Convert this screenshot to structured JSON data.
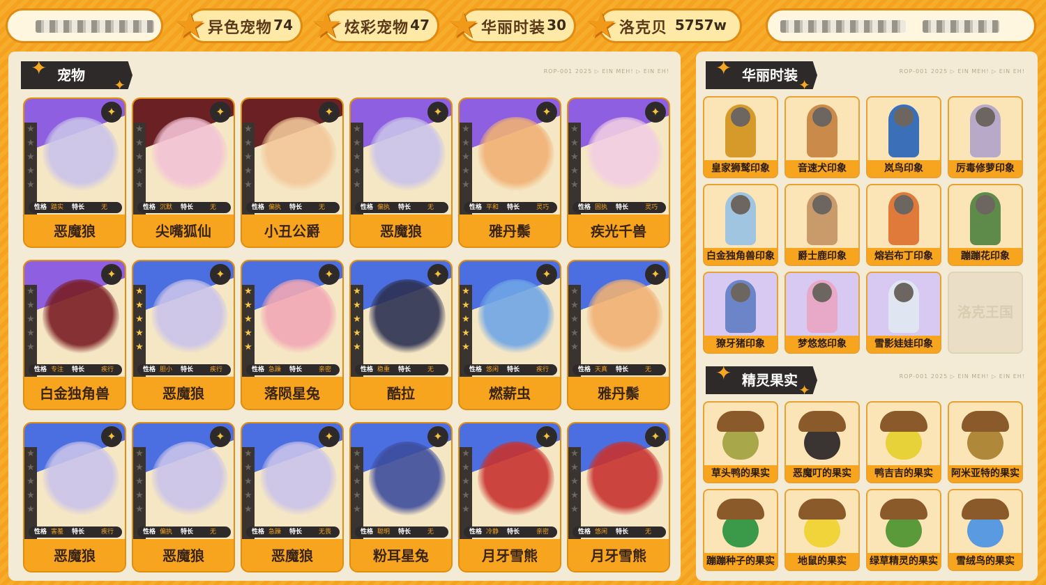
{
  "topbar": {
    "stats": [
      {
        "label": "异色宠物",
        "value": "74"
      },
      {
        "label": "炫彩宠物",
        "value": "47"
      },
      {
        "label": "华丽时装",
        "value": "30"
      },
      {
        "label": "洛克贝",
        "value": "5757w"
      }
    ]
  },
  "pets_panel": {
    "title": "宠物",
    "tiny": "ROP-001  2025  ▷ EIN MEH! ▷ EIN EH!",
    "attr_k1": "性格",
    "attr_k2": "特长",
    "cards": [
      {
        "name": "恶魔狼",
        "trait": "踏实",
        "skill": "无",
        "theme": "purple",
        "badge": "✦",
        "color": "#c9c3ea",
        "stars": 0
      },
      {
        "name": "尖嘴狐仙",
        "trait": "沉默",
        "skill": "无",
        "theme": "dark",
        "badge": "✦",
        "color": "#f3c2d6",
        "stars": 0
      },
      {
        "name": "小丑公爵",
        "trait": "偏执",
        "skill": "无",
        "theme": "dark",
        "badge": "✦",
        "color": "#f2c79a",
        "stars": 0
      },
      {
        "name": "恶魔狼",
        "trait": "偏执",
        "skill": "无",
        "theme": "purple",
        "badge": "✦",
        "color": "#c9c3ea",
        "stars": 0
      },
      {
        "name": "雅丹鬃",
        "trait": "平和",
        "skill": "灵巧",
        "theme": "purple",
        "badge": "✦",
        "color": "#f0b074",
        "stars": 0
      },
      {
        "name": "疾光千兽",
        "trait": "固执",
        "skill": "灵巧",
        "theme": "purple",
        "badge": "✦",
        "color": "#f2cde3",
        "stars": 0
      },
      {
        "name": "白金独角兽",
        "trait": "专注",
        "skill": "疾行",
        "theme": "purple",
        "badge": "✦",
        "color": "#7a1d24",
        "stars": 0
      },
      {
        "name": "恶魔狼",
        "trait": "胆小",
        "skill": "疾行",
        "theme": "blue",
        "badge": "✦",
        "color": "#c9c3ea",
        "stars": 5
      },
      {
        "name": "落陨星兔",
        "trait": "急躁",
        "skill": "亲密",
        "theme": "blue",
        "badge": "✦",
        "color": "#f2a7b4",
        "stars": 5
      },
      {
        "name": "酷拉",
        "trait": "稳重",
        "skill": "无",
        "theme": "blue",
        "badge": "✦",
        "color": "#2c3152",
        "stars": 5
      },
      {
        "name": "燃薪虫",
        "trait": "悠闲",
        "skill": "疾行",
        "theme": "blue",
        "badge": "✦",
        "color": "#6fa6e6",
        "stars": 5
      },
      {
        "name": "雅丹鬃",
        "trait": "天真",
        "skill": "无",
        "theme": "blue",
        "badge": "✦",
        "color": "#f0b074",
        "stars": 0
      },
      {
        "name": "恶魔狼",
        "trait": "害羞",
        "skill": "疾行",
        "theme": "blue",
        "badge": "✦",
        "color": "#c9c3ea",
        "stars": 0
      },
      {
        "name": "恶魔狼",
        "trait": "偏执",
        "skill": "无",
        "theme": "blue",
        "badge": "✦",
        "color": "#c9c3ea",
        "stars": 0
      },
      {
        "name": "恶魔狼",
        "trait": "急躁",
        "skill": "无畏",
        "theme": "blue",
        "badge": "✦",
        "color": "#c9c3ea",
        "stars": 0
      },
      {
        "name": "粉耳星兔",
        "trait": "聪明",
        "skill": "无",
        "theme": "blue",
        "badge": "✦",
        "color": "#3d4c9c",
        "stars": 0
      },
      {
        "name": "月牙雪熊",
        "trait": "冷静",
        "skill": "亲密",
        "theme": "blue",
        "badge": "✦",
        "color": "#c8322f",
        "stars": 0
      },
      {
        "name": "月牙雪熊",
        "trait": "悠闲",
        "skill": "无",
        "theme": "blue",
        "badge": "✦",
        "color": "#c8322f",
        "stars": 0
      }
    ]
  },
  "fashion_panel": {
    "title": "华丽时装",
    "tiny": "ROP-001  2025  ▷ EIN MEH! ▷ EIN EH!",
    "items": [
      {
        "name": "皇家狮鹫印象",
        "color": "#d69a2a",
        "bg": "normal"
      },
      {
        "name": "音速犬印象",
        "color": "#c98a4a",
        "bg": "normal"
      },
      {
        "name": "岚鸟印象",
        "color": "#3b6fb8",
        "bg": "normal"
      },
      {
        "name": "厉毒修萝印象",
        "color": "#b8a9c9",
        "bg": "normal"
      },
      {
        "name": "白金独角兽印象",
        "color": "#9fc5e0",
        "bg": "normal"
      },
      {
        "name": "爵士鹿印象",
        "color": "#c99a6a",
        "bg": "normal"
      },
      {
        "name": "熔岩布丁印象",
        "color": "#e07a3a",
        "bg": "normal"
      },
      {
        "name": "蹦蹦花印象",
        "color": "#5e8a4a",
        "bg": "normal"
      },
      {
        "name": "獠牙猪印象",
        "color": "#6c84c8",
        "bg": "lilac"
      },
      {
        "name": "梦悠悠印象",
        "color": "#e8a9c8",
        "bg": "lilac"
      },
      {
        "name": "雪影娃娃印象",
        "color": "#dfe6f2",
        "bg": "lilac"
      }
    ],
    "empty_watermark": "洛克王国"
  },
  "fruit_panel": {
    "title": "精灵果实",
    "tiny": "ROP-001  2025  ▷ EIN MEH! ▷ EIN EH!",
    "items": [
      {
        "name": "草头鸭的果实",
        "color": "#a8a84a"
      },
      {
        "name": "恶魔叮的果实",
        "color": "#3a3432"
      },
      {
        "name": "鸭吉吉的果实",
        "color": "#e8d23a"
      },
      {
        "name": "阿米亚特的果实",
        "color": "#b0883a"
      },
      {
        "name": "蹦蹦种子的果实",
        "color": "#3a9a4a"
      },
      {
        "name": "地鼠的果实",
        "color": "#f0d43a"
      },
      {
        "name": "绿草精灵的果实",
        "color": "#5a9a3a"
      },
      {
        "name": "雪绒鸟的果实",
        "color": "#5a9ae0"
      }
    ]
  }
}
